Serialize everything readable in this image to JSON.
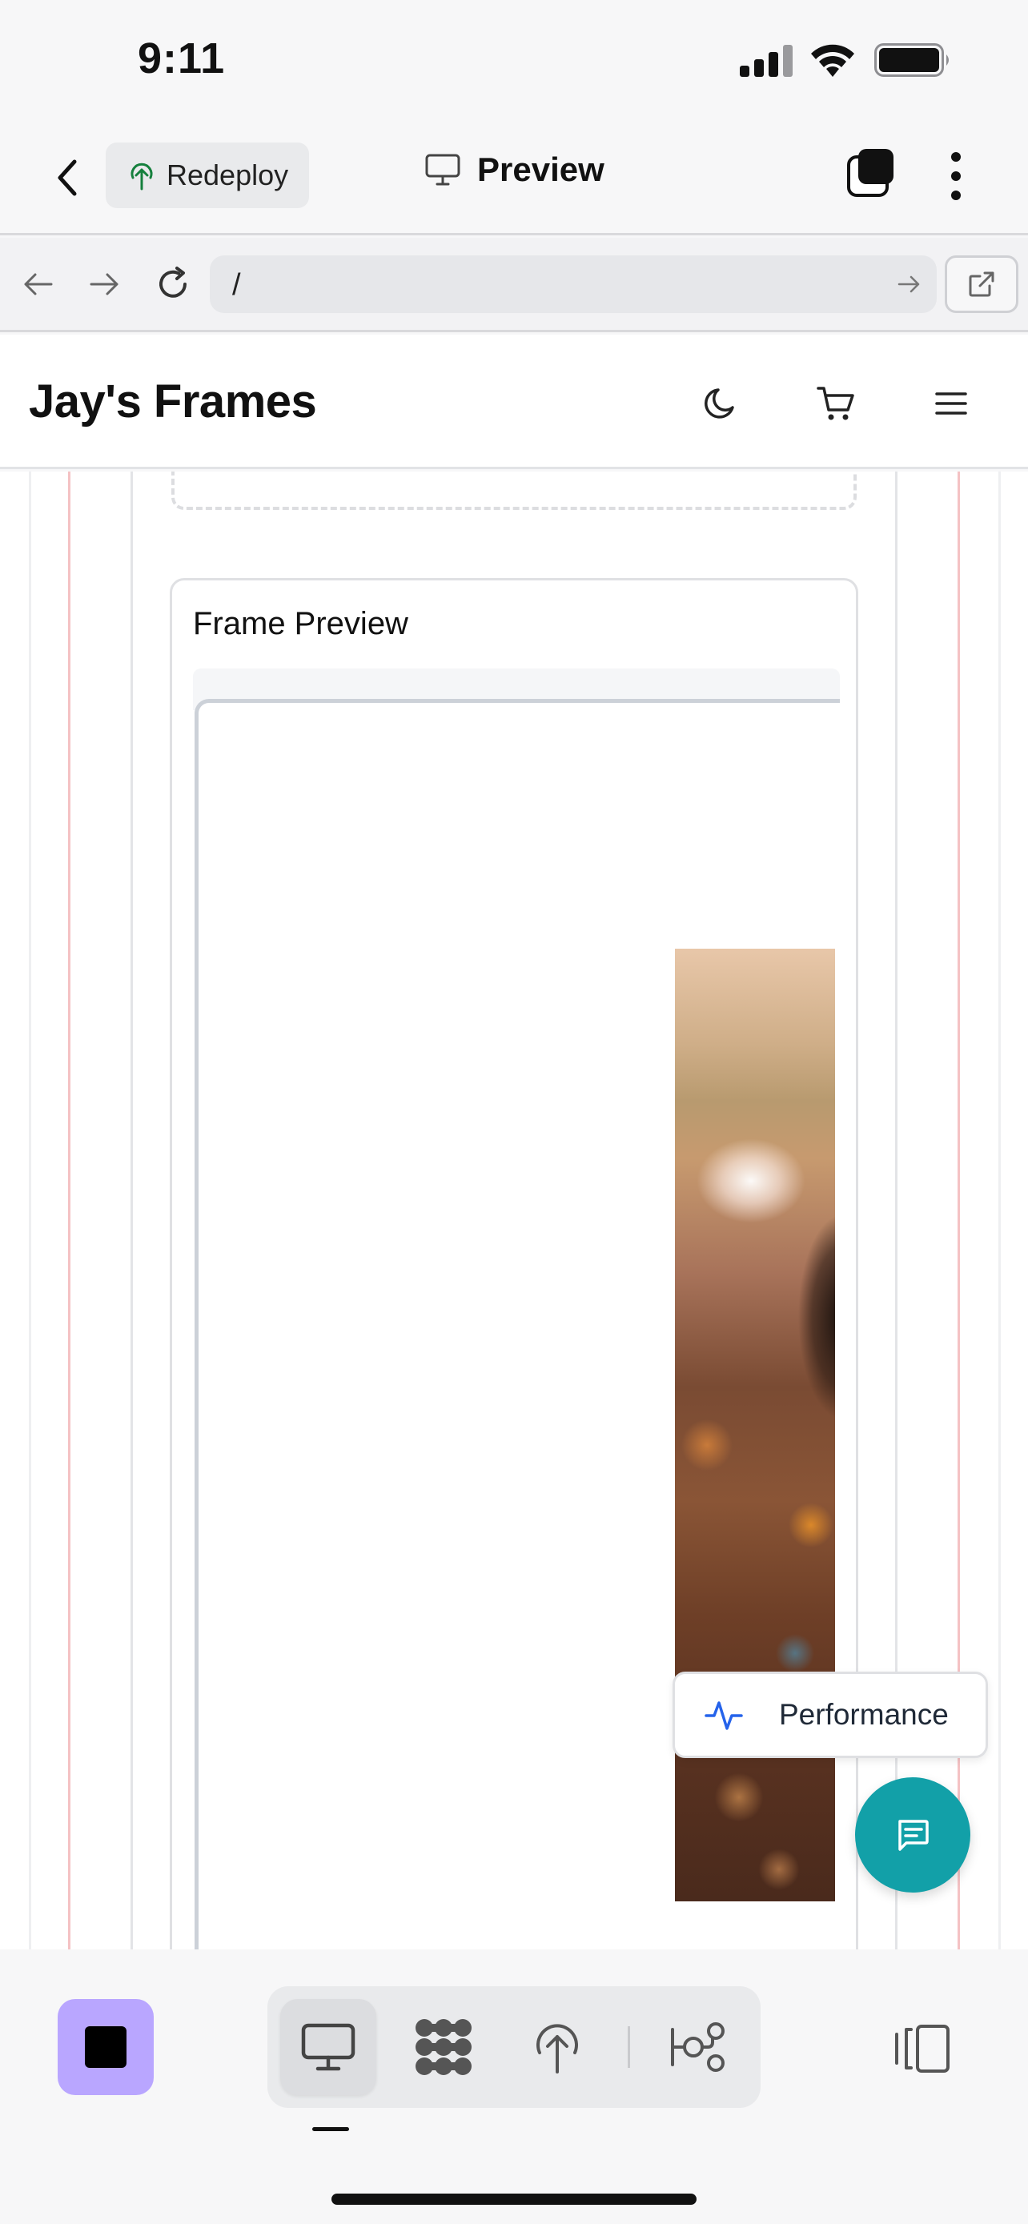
{
  "status_bar": {
    "time": "9:11"
  },
  "app_toolbar": {
    "redeploy_label": "Redeploy",
    "title": "Preview"
  },
  "browser": {
    "url": "/"
  },
  "site": {
    "brand": "Jay's Frames"
  },
  "main": {
    "card_title": "Frame Preview"
  },
  "floating": {
    "performance_label": "Performance"
  },
  "icons": {
    "back": "chevron-left-icon",
    "redeploy": "tree-upload-icon",
    "preview": "monitor-icon",
    "tabs": "tabs-icon",
    "more": "more-vertical-icon",
    "nav_back": "arrow-left-icon",
    "nav_forward": "arrow-right-icon",
    "reload": "reload-icon",
    "go": "arrow-right-icon",
    "external": "external-link-icon",
    "theme": "moon-icon",
    "cart": "cart-icon",
    "menu": "hamburger-icon",
    "performance": "activity-icon",
    "chat": "chat-icon",
    "stop": "stop-icon",
    "desktop": "monitor-icon",
    "graph": "nodes-icon",
    "deploy": "tree-upload-icon",
    "flow": "git-flow-icon",
    "panel": "panel-toggle-icon"
  },
  "colors": {
    "accent_purple": "#b9a6ff",
    "chat_teal": "#12a0a8",
    "guide_red": "#f4c2c4",
    "perf_icon_blue": "#2563eb"
  }
}
